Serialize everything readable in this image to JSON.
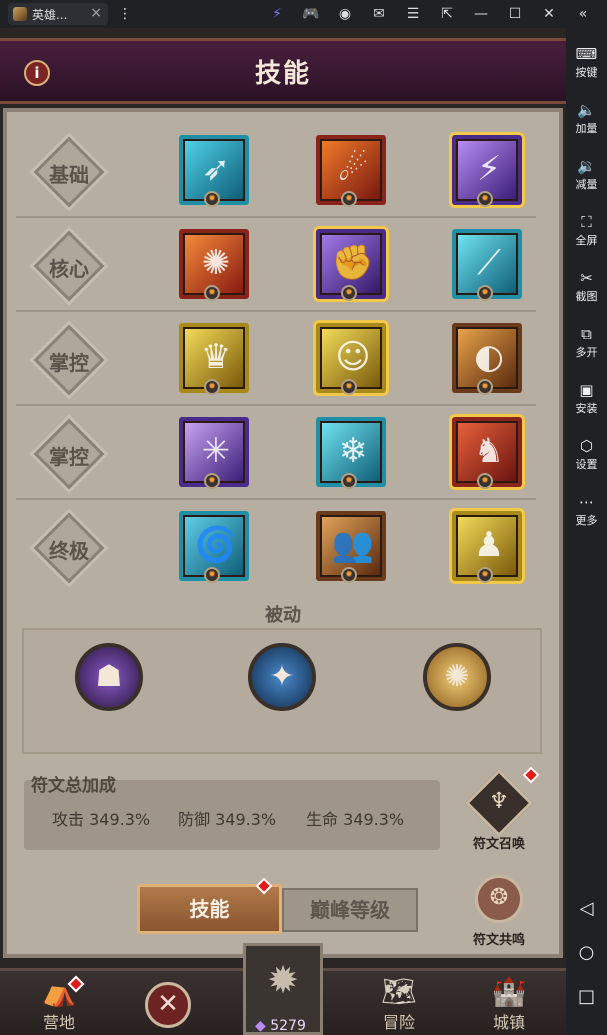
{
  "topbar": {
    "tab_title": "英雄...",
    "close": "×",
    "icons": [
      "menu-dots-icon",
      "speed-icon",
      "gamepad-icon",
      "user-icon",
      "mail-icon",
      "hamburger-icon",
      "export-icon",
      "minimize-icon",
      "maximize-icon",
      "window-close-icon",
      "collapse-icon"
    ]
  },
  "rightbar": {
    "items": [
      {
        "label": "按键",
        "icon": "keyboard-icon"
      },
      {
        "label": "加量",
        "icon": "volume-up-icon"
      },
      {
        "label": "减量",
        "icon": "volume-down-icon"
      },
      {
        "label": "全屏",
        "icon": "fullscreen-icon"
      },
      {
        "label": "截图",
        "icon": "scissors-icon"
      },
      {
        "label": "多开",
        "icon": "multi-instance-icon"
      },
      {
        "label": "安装",
        "icon": "apk-icon"
      },
      {
        "label": "设置",
        "icon": "settings-icon"
      },
      {
        "label": "更多",
        "icon": "more-icon"
      }
    ]
  },
  "header": {
    "title": "技能",
    "info": "i"
  },
  "rows": [
    {
      "label": "基础"
    },
    {
      "label": "核心"
    },
    {
      "label": "掌控"
    },
    {
      "label": "掌控"
    },
    {
      "label": "终极"
    }
  ],
  "passive": {
    "title": "被动"
  },
  "bonus": {
    "title": "符文总加成",
    "attack": "攻击 349.3%",
    "defense": "防御 349.3%",
    "life": "生命 349.3%"
  },
  "rune_summon": {
    "label": "符文召唤"
  },
  "rune_resonance": {
    "label": "符文共鸣"
  },
  "tabs": {
    "active": "技能",
    "inactive": "巅峰等级"
  },
  "bottom_nav": {
    "camp": "营地",
    "adventure": "冒险",
    "town": "城镇",
    "gem_count": "5279"
  },
  "colors": {
    "accent_gold": "#f3c94a",
    "header_purple": "#4a1f3d",
    "panel_bg": "#b7aea2",
    "red_badge": "#e21a1a"
  }
}
